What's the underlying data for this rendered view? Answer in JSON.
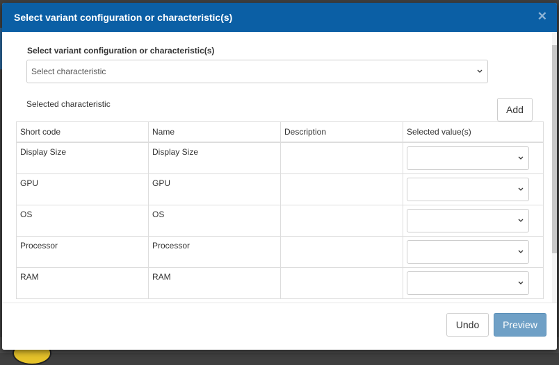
{
  "modal": {
    "title": "Select variant configuration or characteristic(s)",
    "close_icon": "close-icon"
  },
  "form": {
    "field_label": "Select variant configuration or characteristic(s)",
    "select_value": "Select characteristic",
    "selected_label": "Selected characteristic",
    "add_label": "Add"
  },
  "table": {
    "headers": [
      "Short code",
      "Name",
      "Description",
      "Selected value(s)"
    ],
    "rows": [
      {
        "short_code": "Display Size",
        "name": "Display Size",
        "description": ""
      },
      {
        "short_code": "GPU",
        "name": "GPU",
        "description": ""
      },
      {
        "short_code": "OS",
        "name": "OS",
        "description": ""
      },
      {
        "short_code": "Processor",
        "name": "Processor",
        "description": ""
      },
      {
        "short_code": "RAM",
        "name": "RAM",
        "description": ""
      }
    ]
  },
  "footer": {
    "undo_label": "Undo",
    "preview_label": "Preview"
  },
  "colors": {
    "header_bg": "#0b5fa5",
    "primary_button": "#6fa0c6"
  }
}
